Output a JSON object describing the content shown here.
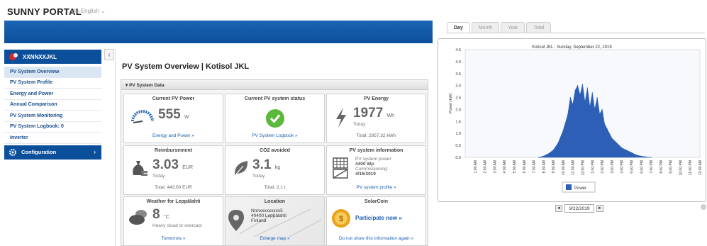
{
  "header": {
    "logo": "SUNNY PORTAL",
    "language": "US-English ⌄"
  },
  "sidebar": {
    "plant_name": "XXNNXXJKL",
    "items": [
      {
        "label": "PV System Overview",
        "active": true
      },
      {
        "label": "PV System Profile",
        "active": false
      },
      {
        "label": "Energy and Power",
        "active": false
      },
      {
        "label": "Annual Comparison",
        "active": false
      },
      {
        "label": "PV System Monitoring",
        "active": false
      },
      {
        "label": "PV System Logbook: 0",
        "active": false
      },
      {
        "label": "Inverter",
        "active": false
      }
    ],
    "configuration": "Configuration",
    "collapse": "‹"
  },
  "main": {
    "title": "PV System Overview | Kotisol JKL",
    "panel_title": "▾ PV System Data",
    "tiles": {
      "pv_power": {
        "title": "Current PV Power",
        "value": "555",
        "unit": "W",
        "link": "Energy and Power »"
      },
      "status": {
        "title": "Current PV system status",
        "link": "PV System Logbook »"
      },
      "energy": {
        "title": "PV Energy",
        "value": "1977",
        "unit": "Wh",
        "sub": "Today",
        "footer": "Total: 2957.32 kWh"
      },
      "reimbursement": {
        "title": "Reimbursement",
        "value": "3.03",
        "unit": "EUR",
        "sub": "Today",
        "footer": "Total: 443.60 EUR"
      },
      "co2": {
        "title": "CO2 avoided",
        "value": "3.1",
        "unit": "kg",
        "sub": "Today",
        "footer": "Total: 2.1 t"
      },
      "info": {
        "title": "PV system information",
        "line1": "PV system power:",
        "line2": "4400 Wp",
        "line3": "Commissioning:",
        "line4": "4/16/2019",
        "link": "PV system profile »"
      },
      "weather": {
        "title": "Weather for Leppälahti",
        "value": "8",
        "unit": "°C",
        "desc": "Heavy cloud or overcast",
        "link": "Tomorrow »"
      },
      "location": {
        "title": "Location",
        "addr1": "Nnnxxxxxxxxx5",
        "addr2": "40400 Leppälahti",
        "addr3": "Finland",
        "link": "Enlarge map »"
      },
      "solarcoin": {
        "title": "SolarCoin",
        "cta": "Participate now »",
        "link": "Do not show this information again »"
      }
    }
  },
  "chart_panel": {
    "tabs": [
      {
        "label": "Day",
        "active": true
      },
      {
        "label": "Month",
        "active": false
      },
      {
        "label": "Year",
        "active": false
      },
      {
        "label": "Total",
        "active": false
      }
    ],
    "date": "9/22/2019",
    "prev": "◄",
    "next": "►"
  },
  "chart_data": {
    "type": "area",
    "title": "Kotisol JKL : Sunday, September 22, 2019",
    "ylabel": "Power [kW]",
    "xlabel": "",
    "ylim": [
      0,
      4.5
    ],
    "yticks": [
      "0.0",
      "0.5",
      "1.0",
      "1.5",
      "2.0",
      "2.5",
      "3.0",
      "3.5",
      "4.0",
      "4.5"
    ],
    "xticks": [
      "1:00 AM",
      "2:00 AM",
      "3:00 AM",
      "4:00 AM",
      "5:00 AM",
      "6:00 AM",
      "7:00 AM",
      "8:00 AM",
      "9:00 AM",
      "10:00 AM",
      "11:00 AM",
      "12:00 PM",
      "1:00 PM",
      "2:00 PM",
      "3:00 PM",
      "4:00 PM",
      "5:00 PM",
      "6:00 PM",
      "7:00 PM",
      "8:00 PM",
      "9:00 PM",
      "10:00 PM",
      "11:00 PM",
      "12:00 AM"
    ],
    "series": [
      {
        "name": "Power",
        "color": "#2d5fb7",
        "x": [
          7.5,
          8,
          8.5,
          9,
          9.5,
          10,
          10.5,
          10.75,
          11,
          11.25,
          11.5,
          11.75,
          12,
          12.25,
          12.5,
          12.75,
          13,
          13.25,
          13.5,
          13.75,
          14,
          14.25,
          14.5,
          15,
          15.5,
          16,
          16.5,
          17,
          17.5,
          18,
          18.5,
          19
        ],
        "y": [
          0,
          0.05,
          0.15,
          0.3,
          0.6,
          1.1,
          1.8,
          2.5,
          2.2,
          2.8,
          3.0,
          2.6,
          3.05,
          2.3,
          2.9,
          2.1,
          2.7,
          2.0,
          2.5,
          1.8,
          2.0,
          1.4,
          1.2,
          0.8,
          0.6,
          0.4,
          0.3,
          0.2,
          0.1,
          0.05,
          0.02,
          0
        ]
      }
    ],
    "legend": "bottom-center",
    "grid": false
  }
}
